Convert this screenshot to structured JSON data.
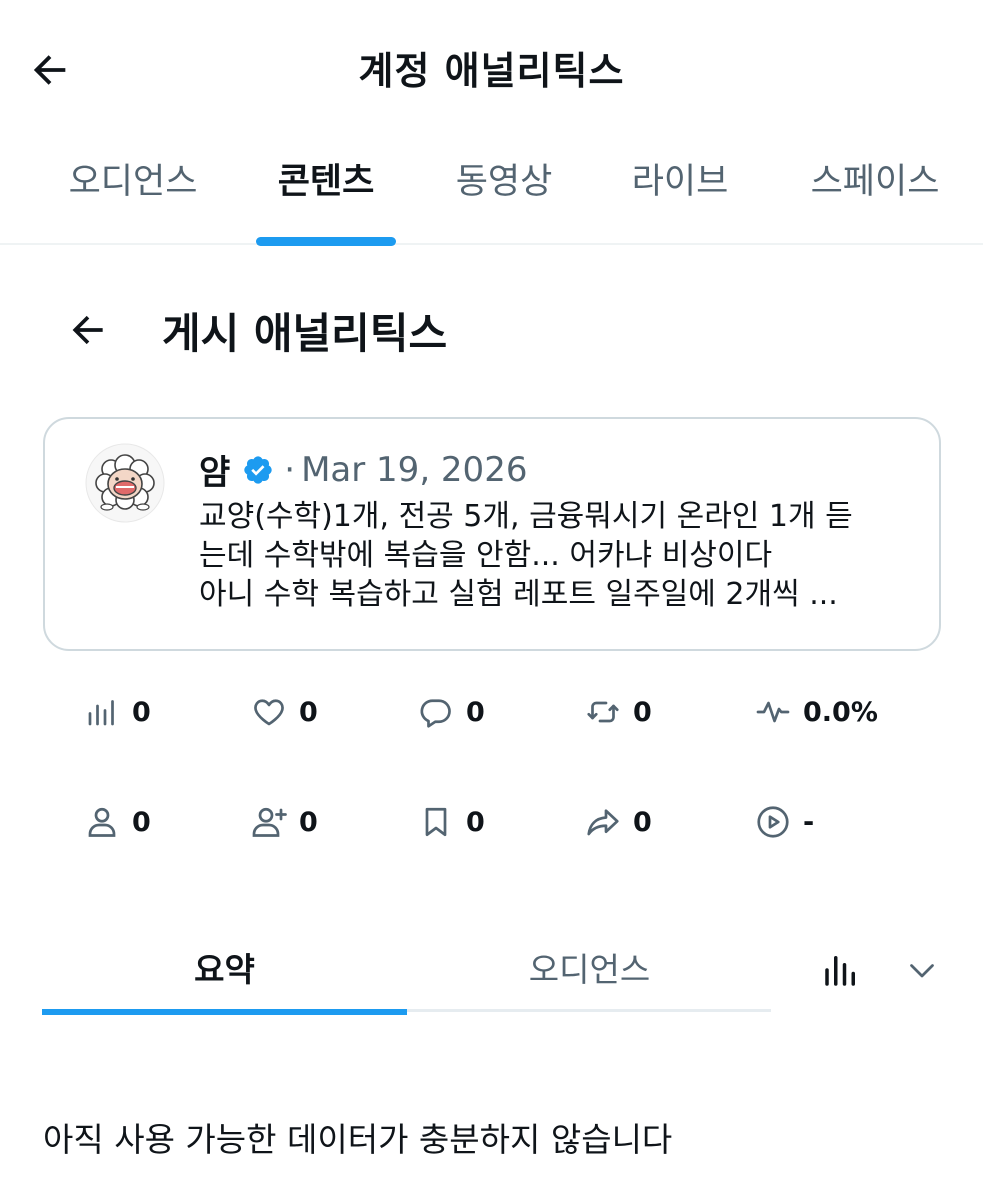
{
  "header": {
    "title": "계정 애널리틱스",
    "back_icon": "arrow-left-icon"
  },
  "tabs": [
    {
      "label": "오디언스",
      "active": false
    },
    {
      "label": "콘텐츠",
      "active": true
    },
    {
      "label": "동영상",
      "active": false
    },
    {
      "label": "라이브",
      "active": false
    },
    {
      "label": "스페이스",
      "active": false
    }
  ],
  "section": {
    "title": "게시 애널리틱스",
    "back_icon": "arrow-left-icon"
  },
  "post": {
    "author": "얌",
    "verified": true,
    "separator": "·",
    "date": "Mar 19, 2026",
    "lines": [
      "교양(수학)1개, 전공 5개, 금융뭐시기 온라인 1개 듣",
      "는데 수학밖에 복습을 안함... 어카냐 비상이다",
      "아니 수학 복습하고 실험 레포트 일주일에 2개씩 ..."
    ]
  },
  "metrics": [
    {
      "icon": "bar-chart-icon",
      "value": "0"
    },
    {
      "icon": "heart-icon",
      "value": "0"
    },
    {
      "icon": "reply-icon",
      "value": "0"
    },
    {
      "icon": "repost-icon",
      "value": "0"
    },
    {
      "icon": "pulse-icon",
      "value": "0.0%"
    },
    {
      "icon": "person-icon",
      "value": "0"
    },
    {
      "icon": "person-add-icon",
      "value": "0"
    },
    {
      "icon": "bookmark-icon",
      "value": "0"
    },
    {
      "icon": "share-icon",
      "value": "0"
    },
    {
      "icon": "play-circle-icon",
      "value": "-"
    }
  ],
  "subtabs": [
    {
      "label": "요약",
      "active": true
    },
    {
      "label": "오디언스",
      "active": false
    }
  ],
  "chart_toggle": {
    "icon": "bar-chart-icon",
    "dropdown_icon": "chevron-down-icon"
  },
  "empty_message": "아직 사용 가능한 데이터가 충분하지 않습니다",
  "colors": {
    "accent": "#1d9bf0",
    "text_primary": "#0f1419",
    "text_secondary": "#536471",
    "border": "#cfd9de"
  }
}
